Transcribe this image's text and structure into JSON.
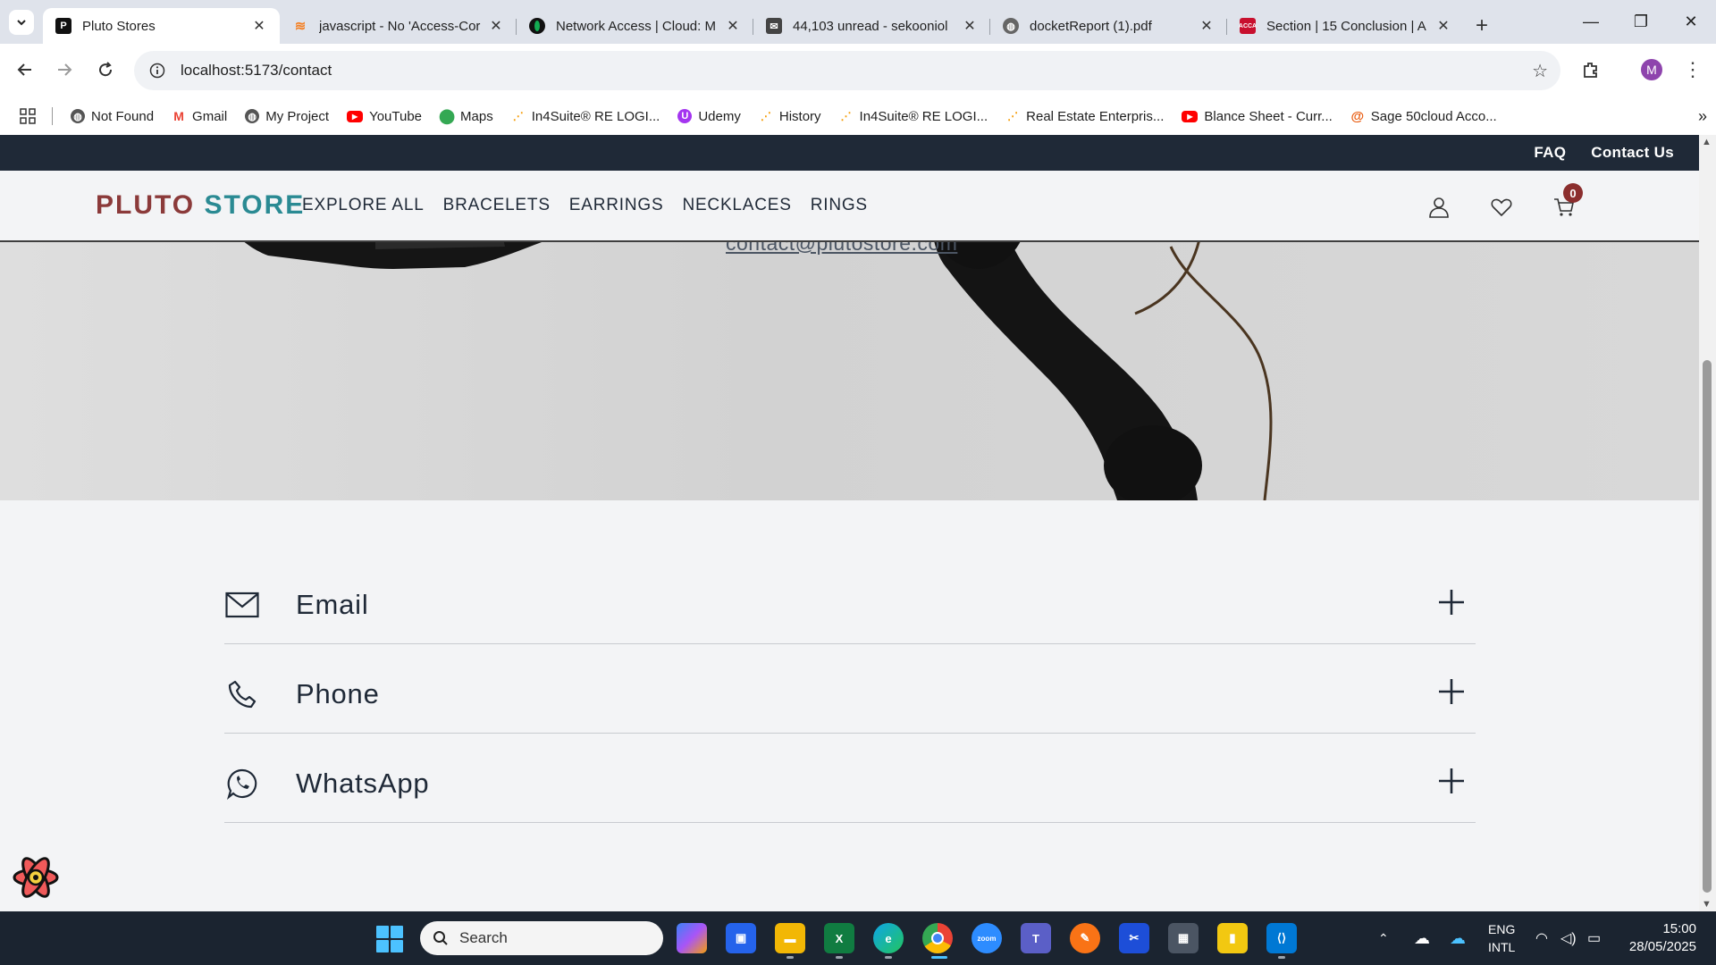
{
  "browser": {
    "tabs": [
      {
        "title": "Pluto Stores",
        "favicon": "pluto-favicon",
        "active": true
      },
      {
        "title": "javascript - No 'Access-Cor",
        "favicon": "stackoverflow-icon"
      },
      {
        "title": "Network Access | Cloud: M",
        "favicon": "mongodb-icon"
      },
      {
        "title": "44,103 unread - sekooniol",
        "favicon": "mail-icon"
      },
      {
        "title": "docketReport (1).pdf",
        "favicon": "globe-icon"
      },
      {
        "title": "Section | 15 Conclusion | A",
        "favicon": "acca-icon"
      }
    ],
    "url": "localhost:5173/contact",
    "profile_initial": "M",
    "bookmarks": [
      {
        "label": "Not Found",
        "icon": "globe-icon",
        "color": "#555555"
      },
      {
        "label": "Gmail",
        "icon": "gmail-icon",
        "color": "#ea4335"
      },
      {
        "label": "My Project",
        "icon": "globe-icon",
        "color": "#555555"
      },
      {
        "label": "YouTube",
        "icon": "youtube-icon",
        "color": "#ff0000"
      },
      {
        "label": "Maps",
        "icon": "maps-icon",
        "color": "#34a853"
      },
      {
        "label": "In4Suite® RE LOGI...",
        "icon": "in4suite-icon",
        "color": "#f59e0b"
      },
      {
        "label": "Udemy",
        "icon": "udemy-icon",
        "color": "#a435f0"
      },
      {
        "label": "History",
        "icon": "in4suite-icon",
        "color": "#f59e0b"
      },
      {
        "label": "In4Suite® RE LOGI...",
        "icon": "in4suite-icon",
        "color": "#f59e0b"
      },
      {
        "label": "Real Estate Enterpris...",
        "icon": "in4suite-icon",
        "color": "#f59e0b"
      },
      {
        "label": "Blance Sheet - Curr...",
        "icon": "youtube-icon",
        "color": "#ff0000"
      },
      {
        "label": "Sage 50cloud Acco...",
        "icon": "sage-icon",
        "color": "#e8590c"
      }
    ]
  },
  "page": {
    "topbar": {
      "faq": "FAQ",
      "contact": "Contact Us"
    },
    "logo": {
      "part1": "PLUTO",
      "part2": "STORE"
    },
    "menu": [
      "EXPLORE ALL",
      "BRACELETS",
      "EARRINGS",
      "NECKLACES",
      "RINGS"
    ],
    "cart_count": "0",
    "hero_email": "contact@plutostore.com",
    "contact_methods": [
      {
        "label": "Email",
        "icon": "mail-icon"
      },
      {
        "label": "Phone",
        "icon": "phone-icon"
      },
      {
        "label": "WhatsApp",
        "icon": "whatsapp-icon"
      }
    ]
  },
  "taskbar": {
    "search_placeholder": "Search",
    "lang_line1": "ENG",
    "lang_line2": "INTL",
    "time": "15:00",
    "date": "28/05/2025"
  },
  "colors": {
    "topbar_bg": "#1f2937",
    "logo_red": "#8b3a3a",
    "logo_teal": "#2a8a93",
    "badge": "#8b2e2e"
  }
}
